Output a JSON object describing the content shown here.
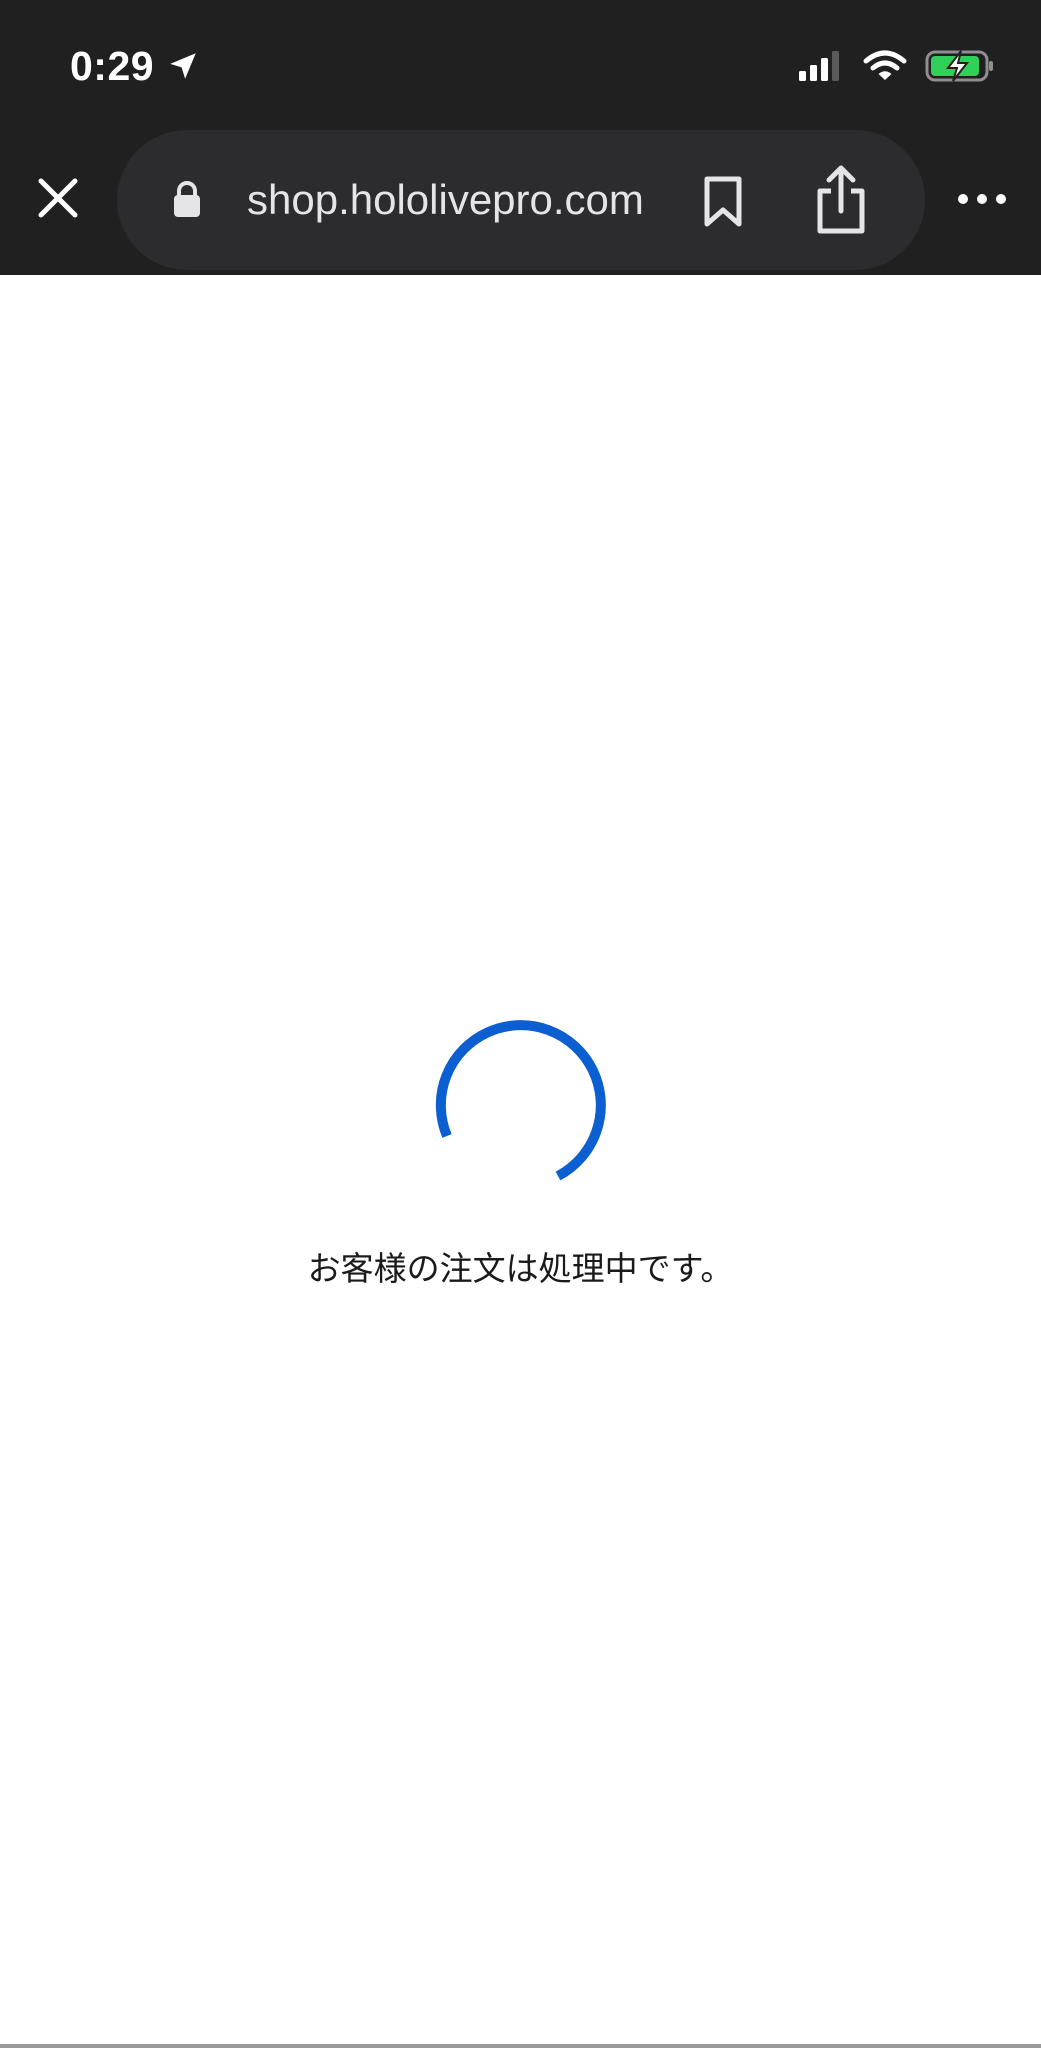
{
  "status_bar": {
    "time": "0:29",
    "location_icon": "location-arrow-icon",
    "signal_icon": "cellular-signal-icon",
    "wifi_icon": "wifi-icon",
    "battery_icon": "battery-charging-icon",
    "battery_color": "#30d158"
  },
  "browser_bar": {
    "close_icon": "close-icon",
    "lock_icon": "lock-icon",
    "url": "shop.hololivepro.com",
    "bookmark_icon": "bookmark-icon",
    "share_icon": "share-icon",
    "more_icon": "more-icon"
  },
  "page": {
    "spinner_icon": "loading-spinner-icon",
    "accent_color": "#0b5fd0",
    "message": "お客様の注文は処理中です。"
  },
  "colors": {
    "toolbar_background": "#202021",
    "url_pill_background": "#2c2c2e",
    "page_background": "#ffffff"
  }
}
